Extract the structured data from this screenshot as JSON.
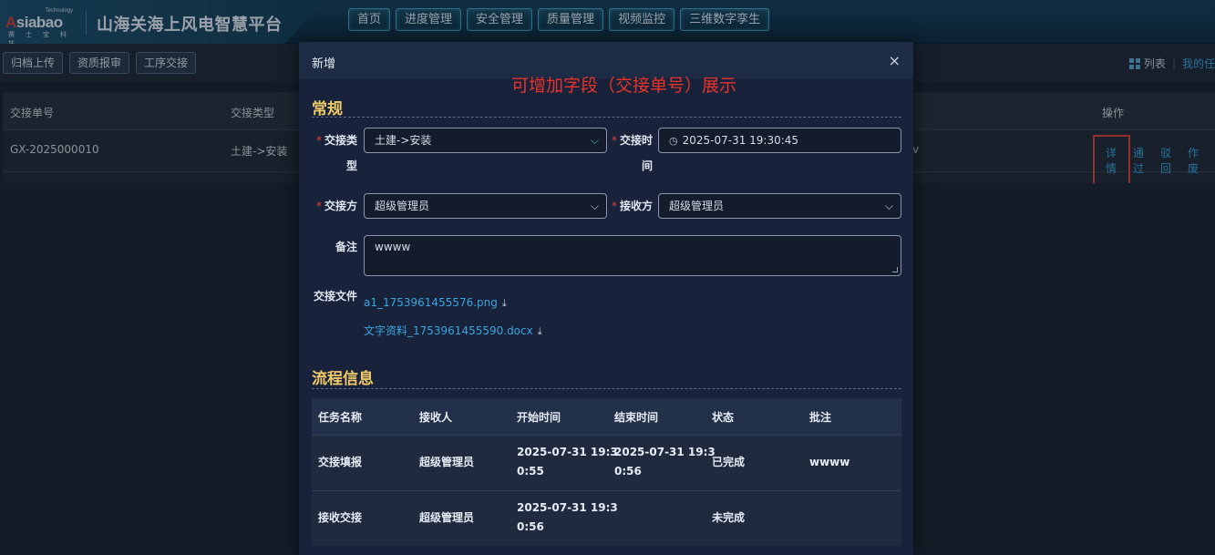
{
  "header": {
    "logo": {
      "tag": "Technology",
      "word_a": "A",
      "word_rest": "siabao",
      "sub": "赛 士 宝 科 技"
    },
    "title": "山海关海上风电智慧平台",
    "nav": [
      "首页",
      "进度管理",
      "安全管理",
      "质量管理",
      "视频监控",
      "三维数字孪生"
    ]
  },
  "toolbar": {
    "buttons": [
      "归档上传",
      "资质报审",
      "工序交接"
    ],
    "view_list": "列表",
    "view_separator": "|",
    "view_mine": "我的任"
  },
  "table": {
    "headers": {
      "col1": "交接单号",
      "col2": "交接类型",
      "ops": "操作"
    },
    "row": {
      "id": "GX-2025000010",
      "type": "土建->安装",
      "hidden_hint": "v"
    },
    "actions": [
      "详情",
      "通过",
      "驳回",
      "作废"
    ]
  },
  "modal": {
    "title": "新增",
    "close": "×",
    "annotation": "可增加字段（交接单号）展示",
    "section_general": "常规",
    "labels": {
      "type_line1": "交接类",
      "type_line2": "型",
      "time_line1": "交接时",
      "time_line2": "间",
      "handover": "交接方",
      "receiver": "接收方",
      "remark": "备注",
      "files": "交接文件"
    },
    "required_mark": "*",
    "values": {
      "type": "土建->安装",
      "time": "2025-07-31 19:30:45",
      "handover": "超级管理员",
      "receiver": "超级管理员",
      "remark": "wwww"
    },
    "files": [
      "a1_1753961455576.png",
      "文字资料_1753961455590.docx"
    ],
    "section_flow": "流程信息",
    "flow_headers": [
      "任务名称",
      "接收人",
      "开始时间",
      "结束时间",
      "状态",
      "批注"
    ],
    "flow_rows": [
      {
        "task": "交接填报",
        "receiver": "超级管理员",
        "start1": "2025-07-31 19:3",
        "start2": "0:55",
        "end1": "2025-07-31 19:3",
        "end2": "0:56",
        "status": "已完成",
        "note": "wwww"
      },
      {
        "task": "接收交接",
        "receiver": "超级管理员",
        "start1": "2025-07-31 19:3",
        "start2": "0:56",
        "end1": "",
        "end2": "",
        "status": "未完成",
        "note": ""
      }
    ]
  },
  "colors": {
    "accent_blue": "#3aa6e0",
    "annotation_red": "#e8332b",
    "section_gold": "#f0c968",
    "required_red": "#e8443a"
  }
}
